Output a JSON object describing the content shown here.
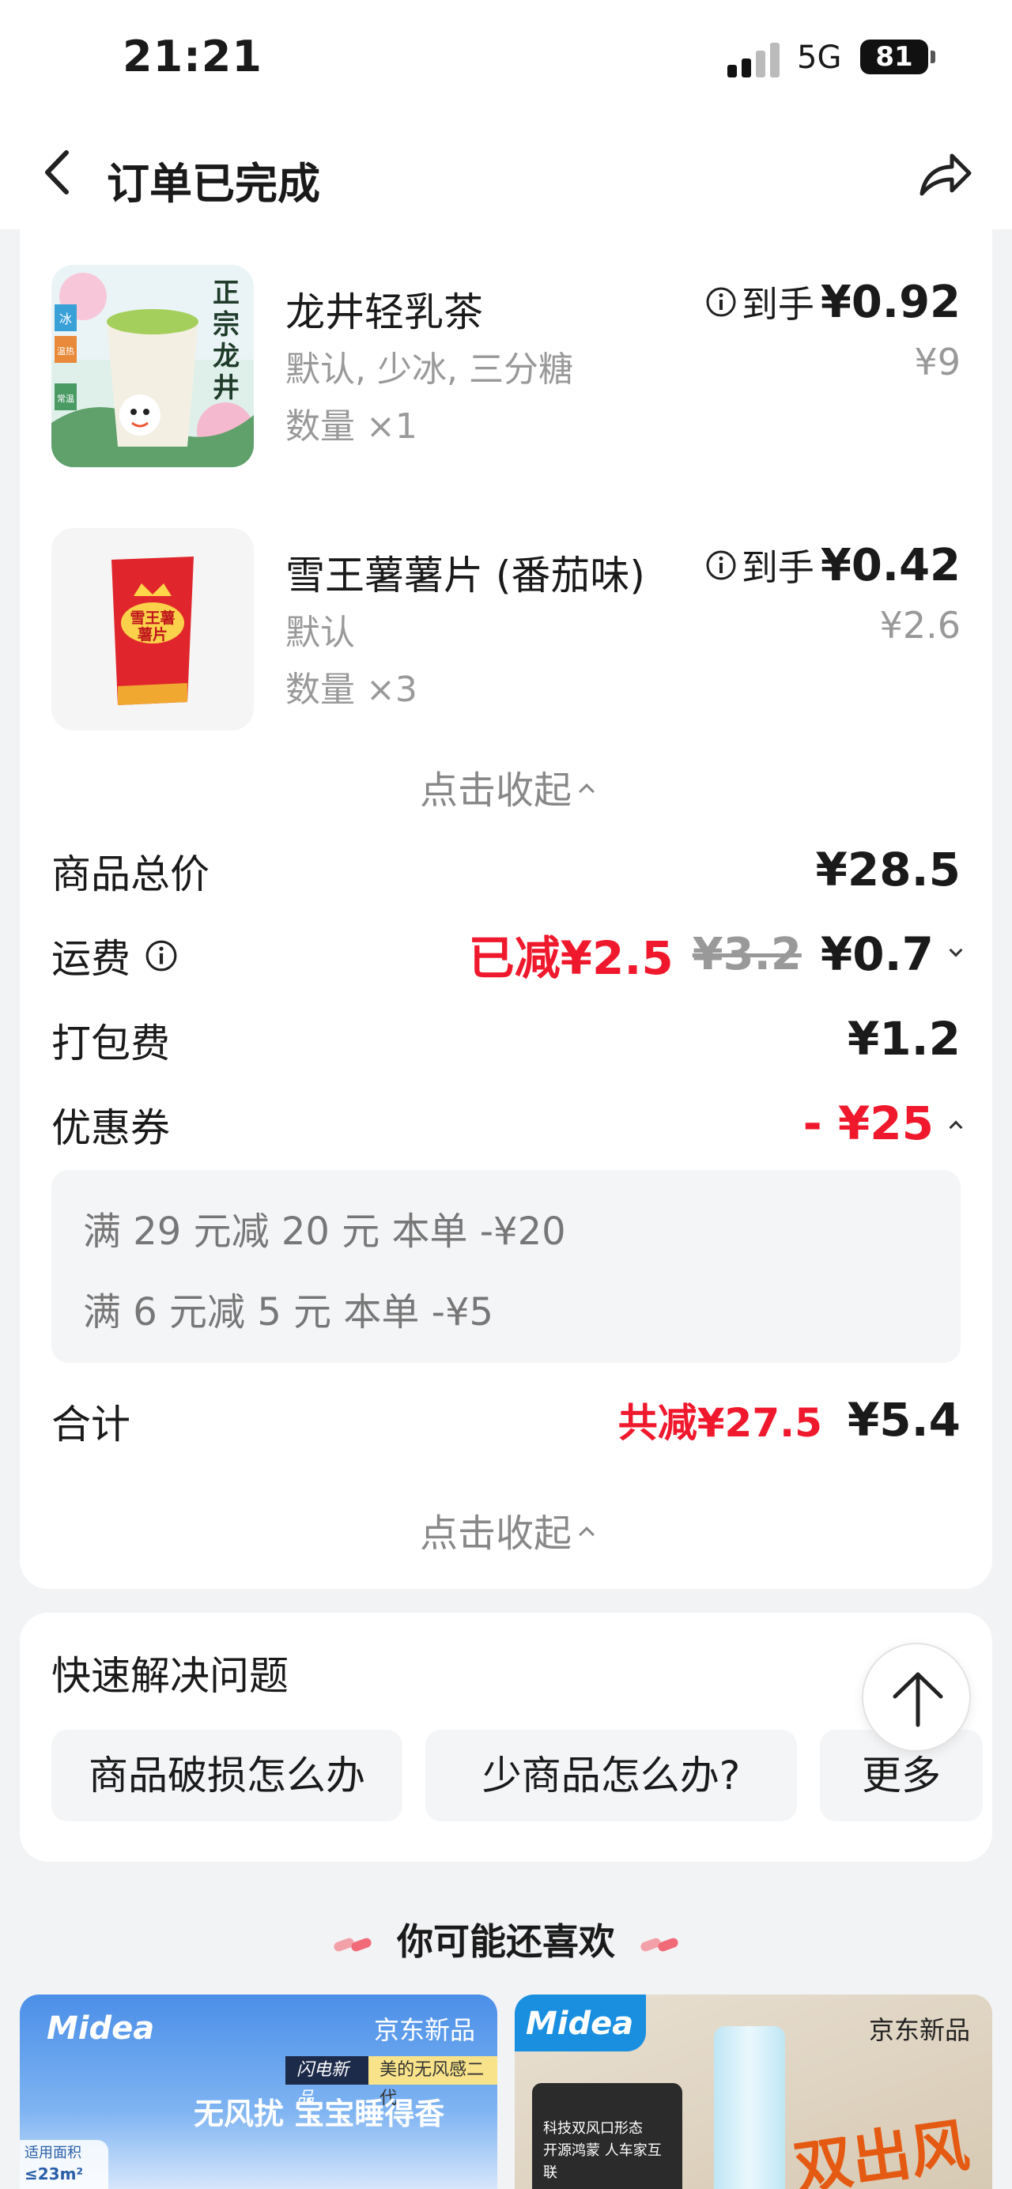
{
  "status_bar": {
    "time": "21:21",
    "network": "5G",
    "battery": "81"
  },
  "nav": {
    "title": "订单已完成"
  },
  "products": [
    {
      "name": "龙井轻乳茶",
      "spec": "默认, 少冰, 三分糖",
      "qty": "数量 ×1",
      "daoshou": "到手",
      "final_price": "¥0.92",
      "orig_price": "¥9",
      "thumb_text": "正宗龙井",
      "thumb_tag_1": "冰",
      "thumb_tag_2": "温热",
      "thumb_tag_3": "常温"
    },
    {
      "name": "雪王薯薯片 (番茄味)",
      "spec": "默认",
      "qty": "数量 ×3",
      "daoshou": "到手",
      "final_price": "¥0.42",
      "orig_price": "¥2.6",
      "thumb_text": "雪王薯薯片"
    }
  ],
  "collapse_label": "点击收起",
  "fees": {
    "goods_total": {
      "label": "商品总价",
      "amount": "¥28.5"
    },
    "delivery": {
      "label": "运费",
      "reduced": "已减¥2.5",
      "original": "¥3.2",
      "amount": "¥0.7"
    },
    "packing": {
      "label": "打包费",
      "amount": "¥1.2"
    },
    "coupon": {
      "label": "优惠券",
      "amount": "- ¥25"
    }
  },
  "coupons": [
    {
      "text": "满 29 元减 20 元   本单 -¥20"
    },
    {
      "text": "满 6 元减 5 元   本单 -¥5"
    }
  ],
  "total": {
    "label": "合计",
    "reduced": "共减¥27.5",
    "amount": "¥5.4"
  },
  "help": {
    "title": "快速解决问题",
    "chips": [
      "商品破损怎么办",
      "少商品怎么办?",
      "更多"
    ]
  },
  "recommend": {
    "title": "你可能还喜欢",
    "ads": [
      {
        "brand": "Midea",
        "badge": "京东新品",
        "tag_dark": "闪电新品",
        "tag_yellow": "美的无风感二代",
        "headline": "无风扰 宝宝睡得香",
        "area_label": "适用面积",
        "area_value": "≤23m²"
      },
      {
        "brand": "Midea",
        "badge": "京东新品",
        "line1": "科技双风口形态",
        "line2": "开源鸿蒙 人车家互联",
        "headline": "双出风"
      }
    ]
  },
  "colors": {
    "accent_red": "#f0182c",
    "gray_text": "#999999"
  }
}
